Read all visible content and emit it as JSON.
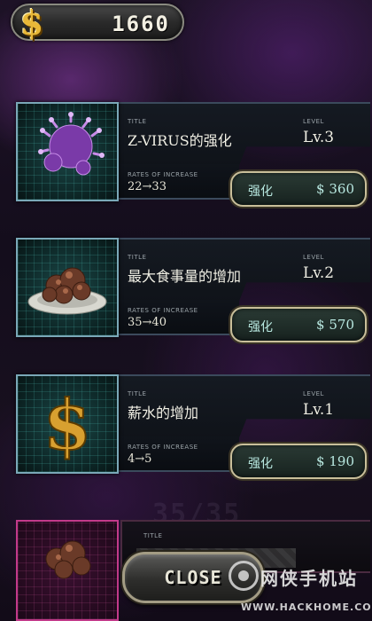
{
  "header": {
    "money_icon": "dollar-sign-icon",
    "money_glyph": "$",
    "money": "1660"
  },
  "labels": {
    "title": "TITLE",
    "level": "LEVEL",
    "rates": "RATES OF INCREASE"
  },
  "upgrades": [
    {
      "icon": "virus-icon",
      "title": "Z-VIRUS的强化",
      "level": "Lv.3",
      "rate": "22→33",
      "button_label": "强化",
      "price": "$ 360"
    },
    {
      "icon": "food-plate-icon",
      "title": "最大食事量的增加",
      "level": "Lv.2",
      "rate": "35→40",
      "button_label": "强化",
      "price": "$ 570"
    },
    {
      "icon": "dollar-sign-icon",
      "title": "薪水的增加",
      "level": "Lv.1",
      "rate": "4→5",
      "button_label": "强化",
      "price": "$ 190"
    }
  ],
  "partial_card": {
    "title_label": "TITLE",
    "icon": "food-plate-icon"
  },
  "background_number": "35/35",
  "close_button": "CLOSE",
  "watermark": {
    "name": "网侠手机站",
    "url": "WWW.HACKHOME.COM"
  },
  "colors": {
    "accent_gold": "#e8b838",
    "button_text": "#b8e8e0",
    "card_border": "#3b4a5c",
    "thumb_border": "#7aa8b8"
  }
}
